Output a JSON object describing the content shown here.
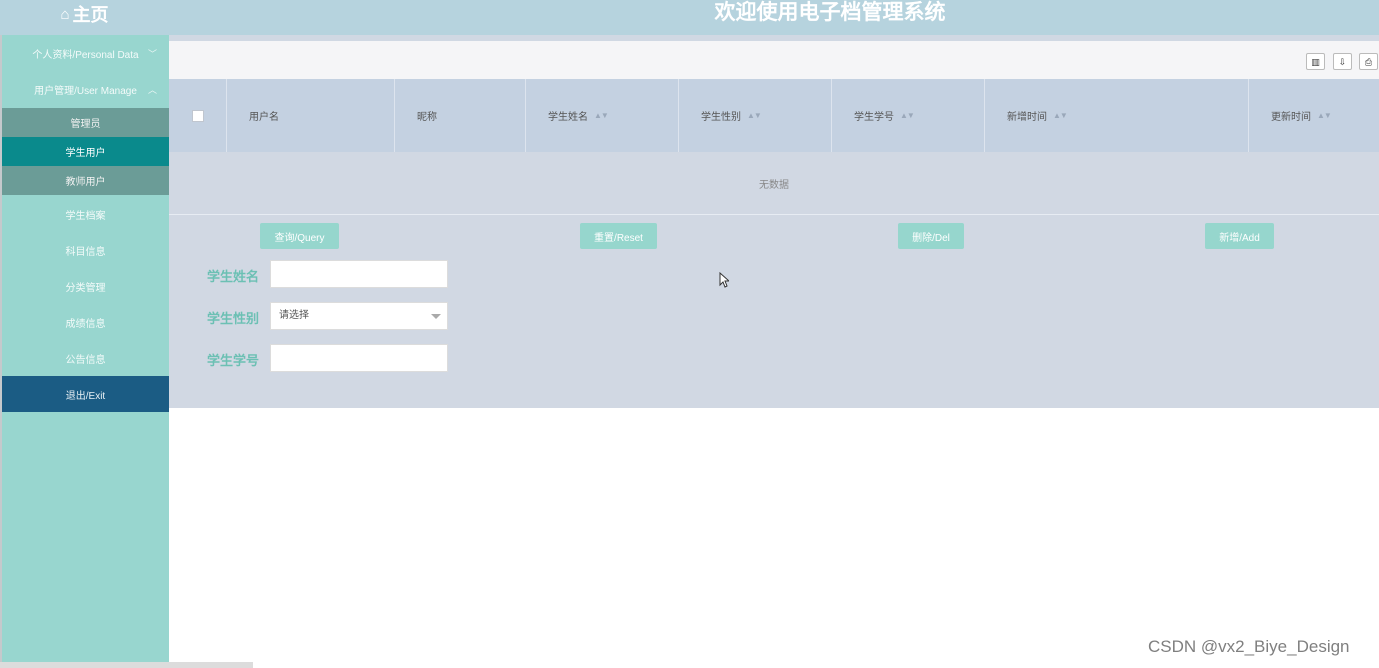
{
  "header": {
    "home_icon": "home-icon",
    "home_label": "主页",
    "app_title": "欢迎使用电子档管理系统"
  },
  "sidebar": {
    "personal_data": "个人资料/Personal Data",
    "user_manage": "用户管理/User Manage",
    "user_manage_sub": [
      {
        "label": "管理员",
        "active": false
      },
      {
        "label": "学生用户",
        "active": true
      },
      {
        "label": "教师用户",
        "active": false
      }
    ],
    "items": [
      "学生档案",
      "科目信息",
      "分类管理",
      "成绩信息",
      "公告信息"
    ],
    "exit": "退出/Exit"
  },
  "toolbar": {
    "icons": [
      "columns-icon",
      "export-icon",
      "print-icon"
    ]
  },
  "table": {
    "columns": [
      {
        "label": "用户名",
        "sortable": false
      },
      {
        "label": "昵称",
        "sortable": false
      },
      {
        "label": "学生姓名",
        "sortable": true
      },
      {
        "label": "学生性别",
        "sortable": true
      },
      {
        "label": "学生学号",
        "sortable": true
      },
      {
        "label": "新增时间",
        "sortable": true
      },
      {
        "label": "更新时间",
        "sortable": true
      }
    ],
    "empty_text": "无数据"
  },
  "actions": {
    "query": "查询/Query",
    "reset": "重置/Reset",
    "delete": "删除/Del",
    "add": "新增/Add"
  },
  "search": {
    "name_label": "学生姓名",
    "name_value": "",
    "gender_label": "学生性别",
    "gender_selected": "请选择",
    "number_label": "学生学号",
    "number_value": ""
  },
  "colors": {
    "header_bg": "#b6d3de",
    "sidebar_bg": "#98d6cf",
    "active_item": "#0a8a8c",
    "exit_bg": "#1b5c84",
    "button_bg": "#96d6cd",
    "label_color": "#6cc0b4"
  },
  "watermark": "CSDN @vx2_Biye_Design"
}
